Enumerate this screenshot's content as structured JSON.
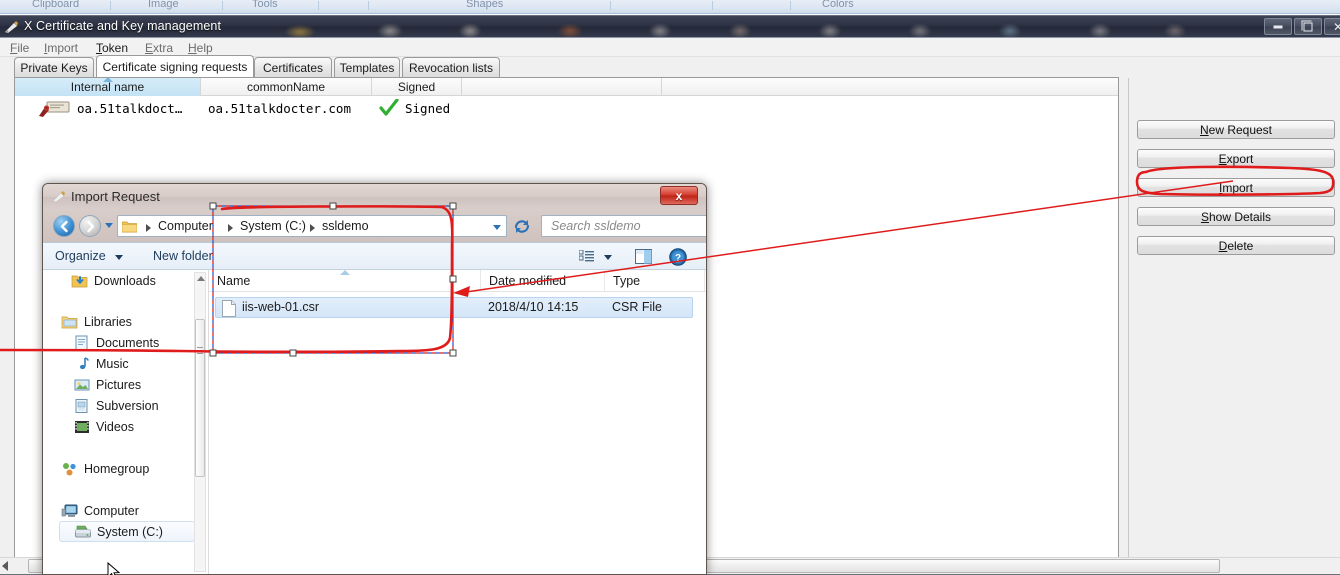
{
  "background_ribbon": {
    "groups": [
      "Clipboard",
      "Image",
      "Tools",
      "Shapes",
      "Colors"
    ]
  },
  "app_window": {
    "title": "X Certificate and Key management",
    "icon": "pen-certificate-icon",
    "window_controls": {
      "minimize": "minimize-icon",
      "restore": "restore-icon",
      "close": "close-icon"
    },
    "menubar": [
      {
        "label": "File",
        "mnemonic": "F",
        "enabled": false
      },
      {
        "label": "Import",
        "mnemonic": "I",
        "enabled": false
      },
      {
        "label": "Token",
        "mnemonic": "T",
        "enabled": true
      },
      {
        "label": "Extra",
        "mnemonic": "E",
        "enabled": false
      },
      {
        "label": "Help",
        "mnemonic": "H",
        "enabled": false
      }
    ],
    "tabs": [
      {
        "label": "Private Keys",
        "selected": false
      },
      {
        "label": "Certificate signing requests",
        "selected": true
      },
      {
        "label": "Certificates",
        "selected": false
      },
      {
        "label": "Templates",
        "selected": false
      },
      {
        "label": "Revocation lists",
        "selected": false
      }
    ],
    "list": {
      "columns": [
        {
          "label": "Internal name",
          "sorted": true
        },
        {
          "label": "commonName",
          "sorted": false
        },
        {
          "label": "Signed",
          "sorted": false
        },
        {
          "label": "",
          "sorted": false
        }
      ],
      "rows": [
        {
          "icon": "certificate-request-icon",
          "internal_name": "oa.51talkdoct…",
          "common_name": "oa.51talkdocter.com",
          "signed_icon": "green-check-icon",
          "signed": "Signed"
        }
      ]
    },
    "side_buttons": [
      {
        "label": "New Request",
        "mnemonic": "N",
        "highlighted": false
      },
      {
        "label": "Export",
        "mnemonic": "E",
        "highlighted": false
      },
      {
        "label": "Import",
        "mnemonic": "I",
        "highlighted": true
      },
      {
        "label": "Show Details",
        "mnemonic": "S",
        "highlighted": false
      },
      {
        "label": "Delete",
        "mnemonic": "D",
        "highlighted": false
      }
    ],
    "scrollbar": {
      "name": "horizontal-scrollbar"
    }
  },
  "dialog": {
    "title": "Import Request",
    "icon": "pen-certificate-icon",
    "close_label": "x",
    "nav": {
      "back_icon": "back-arrow-icon",
      "forward_icon": "forward-arrow-icon",
      "history_dropdown_icon": "chevron-down-icon",
      "refresh_icon": "refresh-icon"
    },
    "address": {
      "folder_icon": "folder-icon",
      "breadcrumbs": [
        "Computer",
        "System (C:)",
        "ssldemo"
      ],
      "dropdown_icon": "chevron-down-icon"
    },
    "search": {
      "placeholder": "Search ssldemo",
      "icon": "search-icon",
      "value": ""
    },
    "toolbar": {
      "organize_label": "Organize",
      "new_folder_label": "New folder",
      "view_icon": "view-list-icon",
      "preview_pane_icon": "preview-pane-icon",
      "help_icon": "help-icon"
    },
    "nav_pane": [
      {
        "label": "Downloads",
        "icon": "downloads-icon",
        "indent": 1,
        "selected": false
      },
      {
        "label": "Libraries",
        "icon": "libraries-icon",
        "indent": 0,
        "selected": false
      },
      {
        "label": "Documents",
        "icon": "documents-icon",
        "indent": 1,
        "selected": false
      },
      {
        "label": "Music",
        "icon": "music-icon",
        "indent": 1,
        "selected": false
      },
      {
        "label": "Pictures",
        "icon": "pictures-icon",
        "indent": 1,
        "selected": false
      },
      {
        "label": "Subversion",
        "icon": "subversion-icon",
        "indent": 1,
        "selected": false
      },
      {
        "label": "Videos",
        "icon": "videos-icon",
        "indent": 1,
        "selected": false
      },
      {
        "label": "Homegroup",
        "icon": "homegroup-icon",
        "indent": 0,
        "selected": false
      },
      {
        "label": "Computer",
        "icon": "computer-icon",
        "indent": 0,
        "selected": false
      },
      {
        "label": "System (C:)",
        "icon": "harddisk-icon",
        "indent": 1,
        "selected": true
      }
    ],
    "file_list": {
      "columns": [
        "Name",
        "Date modified",
        "Type"
      ],
      "sorted_column": "Name",
      "rows": [
        {
          "icon": "file-icon",
          "name": "iis-web-01.csr",
          "date_modified": "2018/4/10 14:15",
          "type": "CSR File",
          "selected": true
        }
      ]
    }
  },
  "annotations": {
    "accent_color": "#e01b1b",
    "import_highlight": "rounded-rect-around-import-button",
    "path_highlight": "rounded-rect-around-address-and-file",
    "arrow": "arrow-from-import-button-to-file-list"
  }
}
